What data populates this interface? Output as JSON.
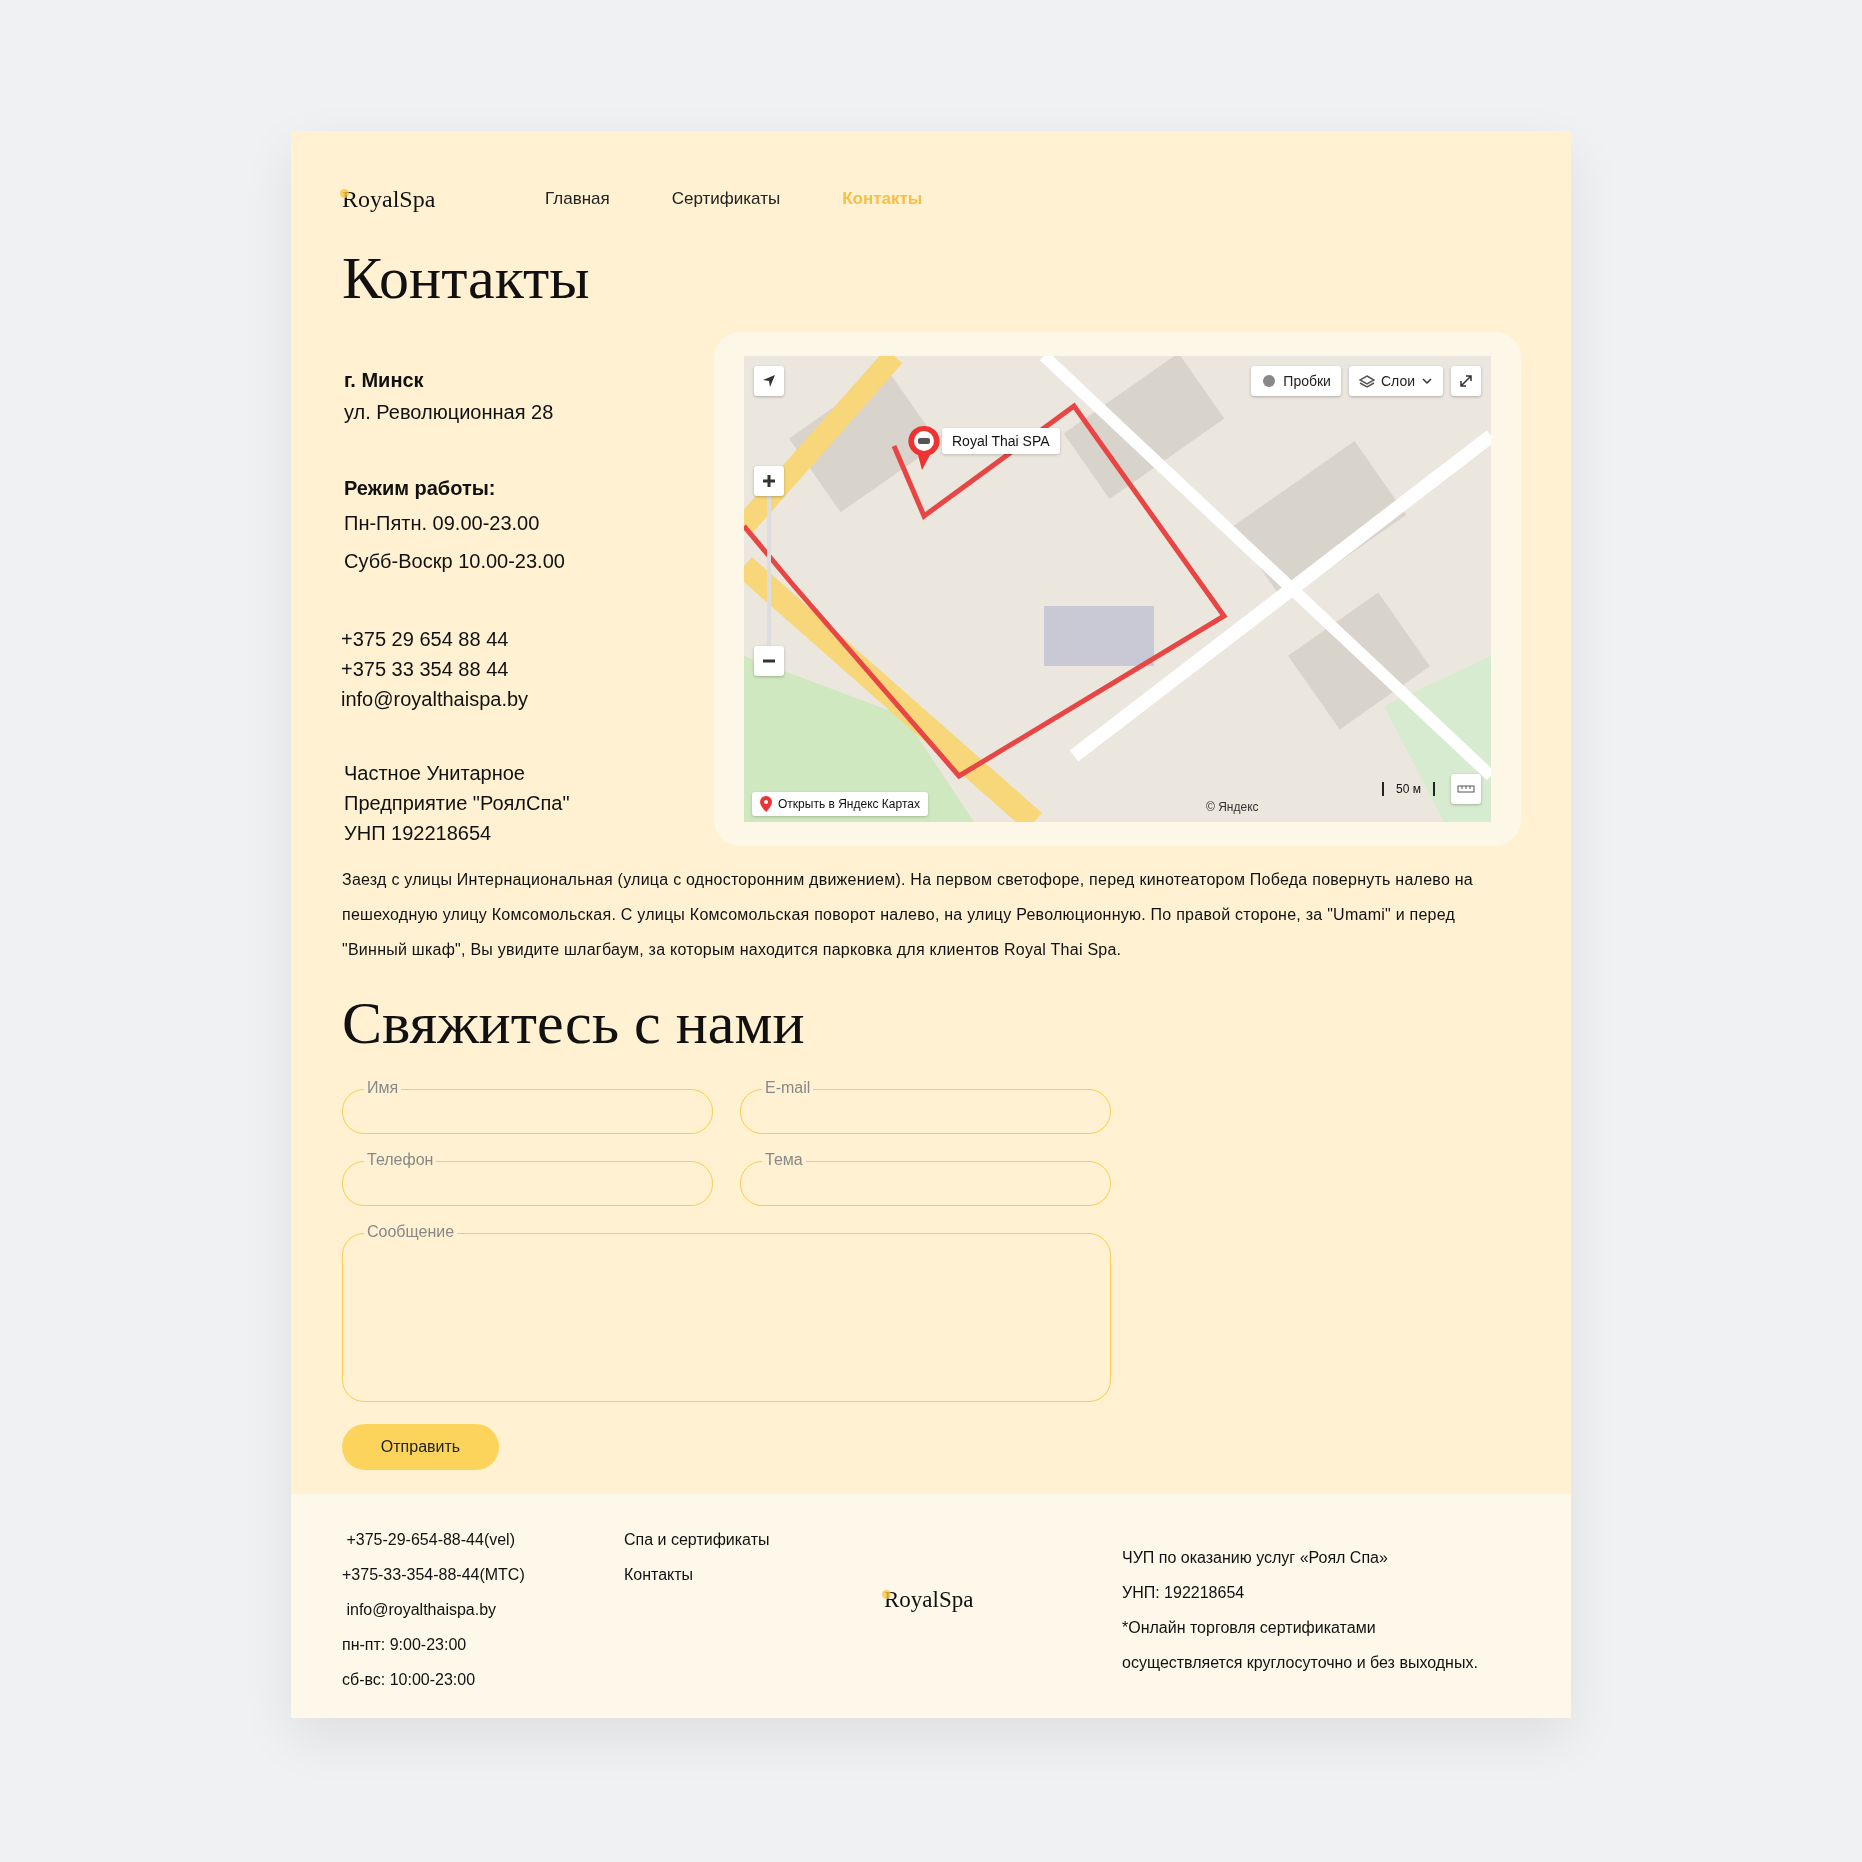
{
  "header": {
    "logo": "RoyalSpa",
    "nav": [
      {
        "label": "Главная",
        "selected": false
      },
      {
        "label": "Сертификаты",
        "selected": false
      },
      {
        "label": "Контакты",
        "selected": true
      }
    ]
  },
  "title": "Контакты",
  "address": {
    "city": "г. Минск",
    "street": "ул. Революционная 28"
  },
  "hours": {
    "heading": "Режим работы:",
    "lines": [
      "Пн-Пятн. 09.00-23.00",
      "Субб-Воскр 10.00-23.00"
    ]
  },
  "contacts": [
    "+375 29 654 88 44",
    "+375 33 354 88 44",
    "info@royalthaispa.by"
  ],
  "company": [
    "Частное Унитарное",
    "Предприятие \"РоялСпа\"",
    "УНП 192218654"
  ],
  "map": {
    "kind": "picture",
    "pin_label": "Royal Thai SPA",
    "traffic": "Пробки",
    "layers": "Слои",
    "open_link": "Открыть в Яндекс Картах",
    "scale": "50 м",
    "copyright": "© Яндекс"
  },
  "directions": "Заезд с улицы Интернациональная (улица с односторонним движением). На первом светофоре, перед кинотеатором Победа повернуть налево на пешеходную улицу Комсомольская. С улицы Комсомольская поворот налево, на улицу Революционную. По правой стороне, за \"Umami\" и перед \"Винный шкаф\", Вы увидите шлагбаум, за которым находится парковка для клиентов Royal Thai Spa.",
  "form": {
    "title": "Свяжитесь с нами",
    "fields": [
      {
        "kind": "input",
        "label": "Имя"
      },
      {
        "kind": "input",
        "label": "E-mail"
      },
      {
        "kind": "input",
        "label": "Телефон"
      },
      {
        "kind": "input",
        "label": "Тема"
      },
      {
        "kind": "textarea",
        "label": "Сообщение"
      }
    ],
    "submit": "Отправить"
  },
  "footer": {
    "contacts": [
      " +375-29-654-88-44(vel)",
      "+375-33-354-88-44(МТС)",
      " info@royalthaispa.by",
      "пн-пт: 9:00-23:00",
      "сб-вс: 10:00-23:00"
    ],
    "links": [
      "Спа и сертификаты",
      "Контакты"
    ],
    "logo": "RoyalSpa",
    "legal": [
      "ЧУП по оказанию услуг «Роял Спа»",
      "УНП: 192218654",
      "*Онлайн торговля сертификатами",
      "осуществляется круглосуточно и без выходных."
    ]
  }
}
